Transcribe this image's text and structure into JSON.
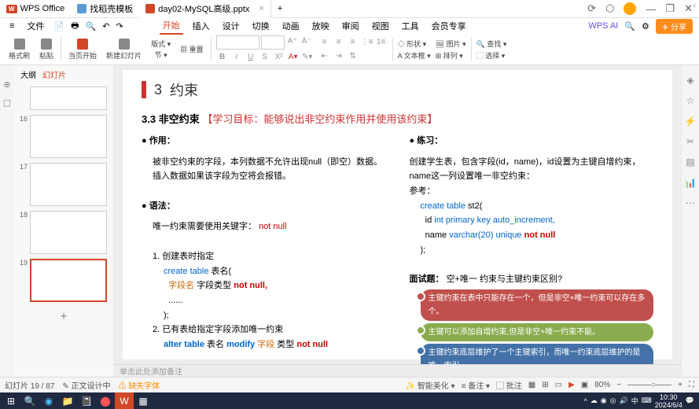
{
  "titlebar": {
    "app_name": "WPS Office",
    "tabs": [
      "找稻壳模板",
      "day02-MySQL高级.pptx"
    ],
    "add_tab": "+"
  },
  "menubar": {
    "file": "文件",
    "items": [
      "开始",
      "插入",
      "设计",
      "切换",
      "动画",
      "放映",
      "审阅",
      "视图",
      "工具",
      "会员专享"
    ],
    "ai": "WPS AI",
    "share": "分享"
  },
  "ribbon": {
    "format_painter": "格式刷",
    "paste": "粘贴",
    "slide_start": "当页开始",
    "new_slide": "新建幻灯片",
    "layout": "版式",
    "section": "节",
    "reset": "重置",
    "shape": "形状",
    "image": "图片",
    "textbox": "文本框",
    "arrange": "排列",
    "find": "查找",
    "select": "选择"
  },
  "thumbnails": {
    "outline": "大纲",
    "slides": "幻灯片",
    "items": [
      {
        "num": "",
        "preview": ""
      },
      {
        "num": "16",
        "preview": ""
      },
      {
        "num": "17",
        "preview": ""
      },
      {
        "num": "18",
        "preview": ""
      },
      {
        "num": "19",
        "preview": ""
      }
    ],
    "add": "+"
  },
  "slide": {
    "number": "3",
    "title": "约束",
    "subtitle_num": "3.3",
    "subtitle_text": "非空约束",
    "goal": "【学习目标：能够说出非空约束作用并使用该约束】",
    "left": {
      "bullet1_title": "作用：",
      "bullet1_text": "被非空约束的字段，本列数据不允许出现null（即空）数据。插入数据如果该字段为空将会报错。",
      "bullet2_title": "语法：",
      "bullet2_text": "唯一约束需要使用关键字：",
      "keyword": "not null",
      "item1_label": "1.",
      "item1_text": "创建表时指定",
      "code1_a": "create table",
      "code1_b": "表名(",
      "code1_c": "字段名",
      "code1_d": "字段类型",
      "code1_e": "not null,",
      "code1_f": "......",
      "code1_g": ");",
      "item2_label": "2.",
      "item2_text": "已有表给指定字段添加唯一约束",
      "code2_a": "alter table",
      "code2_b": "表名",
      "code2_c": "modify",
      "code2_d": "字段",
      "code2_e": "类型",
      "code2_f": "not null"
    },
    "right": {
      "practice_title": "练习：",
      "practice_text": "创建学生表，包含字段(id，name)，id设置为主键自增约束，name这一列设置唯一非空约束：",
      "reference": "参考：",
      "code_a": "create table",
      "code_b": "st2(",
      "code_c": "id",
      "code_d": "int primary key auto_increment,",
      "code_e": "name",
      "code_f": "varchar(20) unique",
      "code_g": "not null",
      "code_h": ");",
      "interview": "面试题：",
      "interview_q": "空+唯一 约束与主键约束区别?",
      "box1": "主键约束在表中只能存在一个，但是非空+唯一约束可以存在多个。",
      "box2": "主键可以添加自增约束,但是非空+唯一约束不能。",
      "box3": "主键约束底层维护了一个主键索引，而唯一约束底层维护的是唯一索引。"
    },
    "notes_placeholder": "单击此处添加备注"
  },
  "statusbar": {
    "slide_info": "幻灯片 19 / 87",
    "design": "正文设计中",
    "missing_font": "缺失字体",
    "beautify": "智能美化",
    "notes": "备注",
    "comments": "批注",
    "zoom": "80%"
  },
  "taskbar": {
    "time": "10:30",
    "date": "2024/6/4"
  }
}
